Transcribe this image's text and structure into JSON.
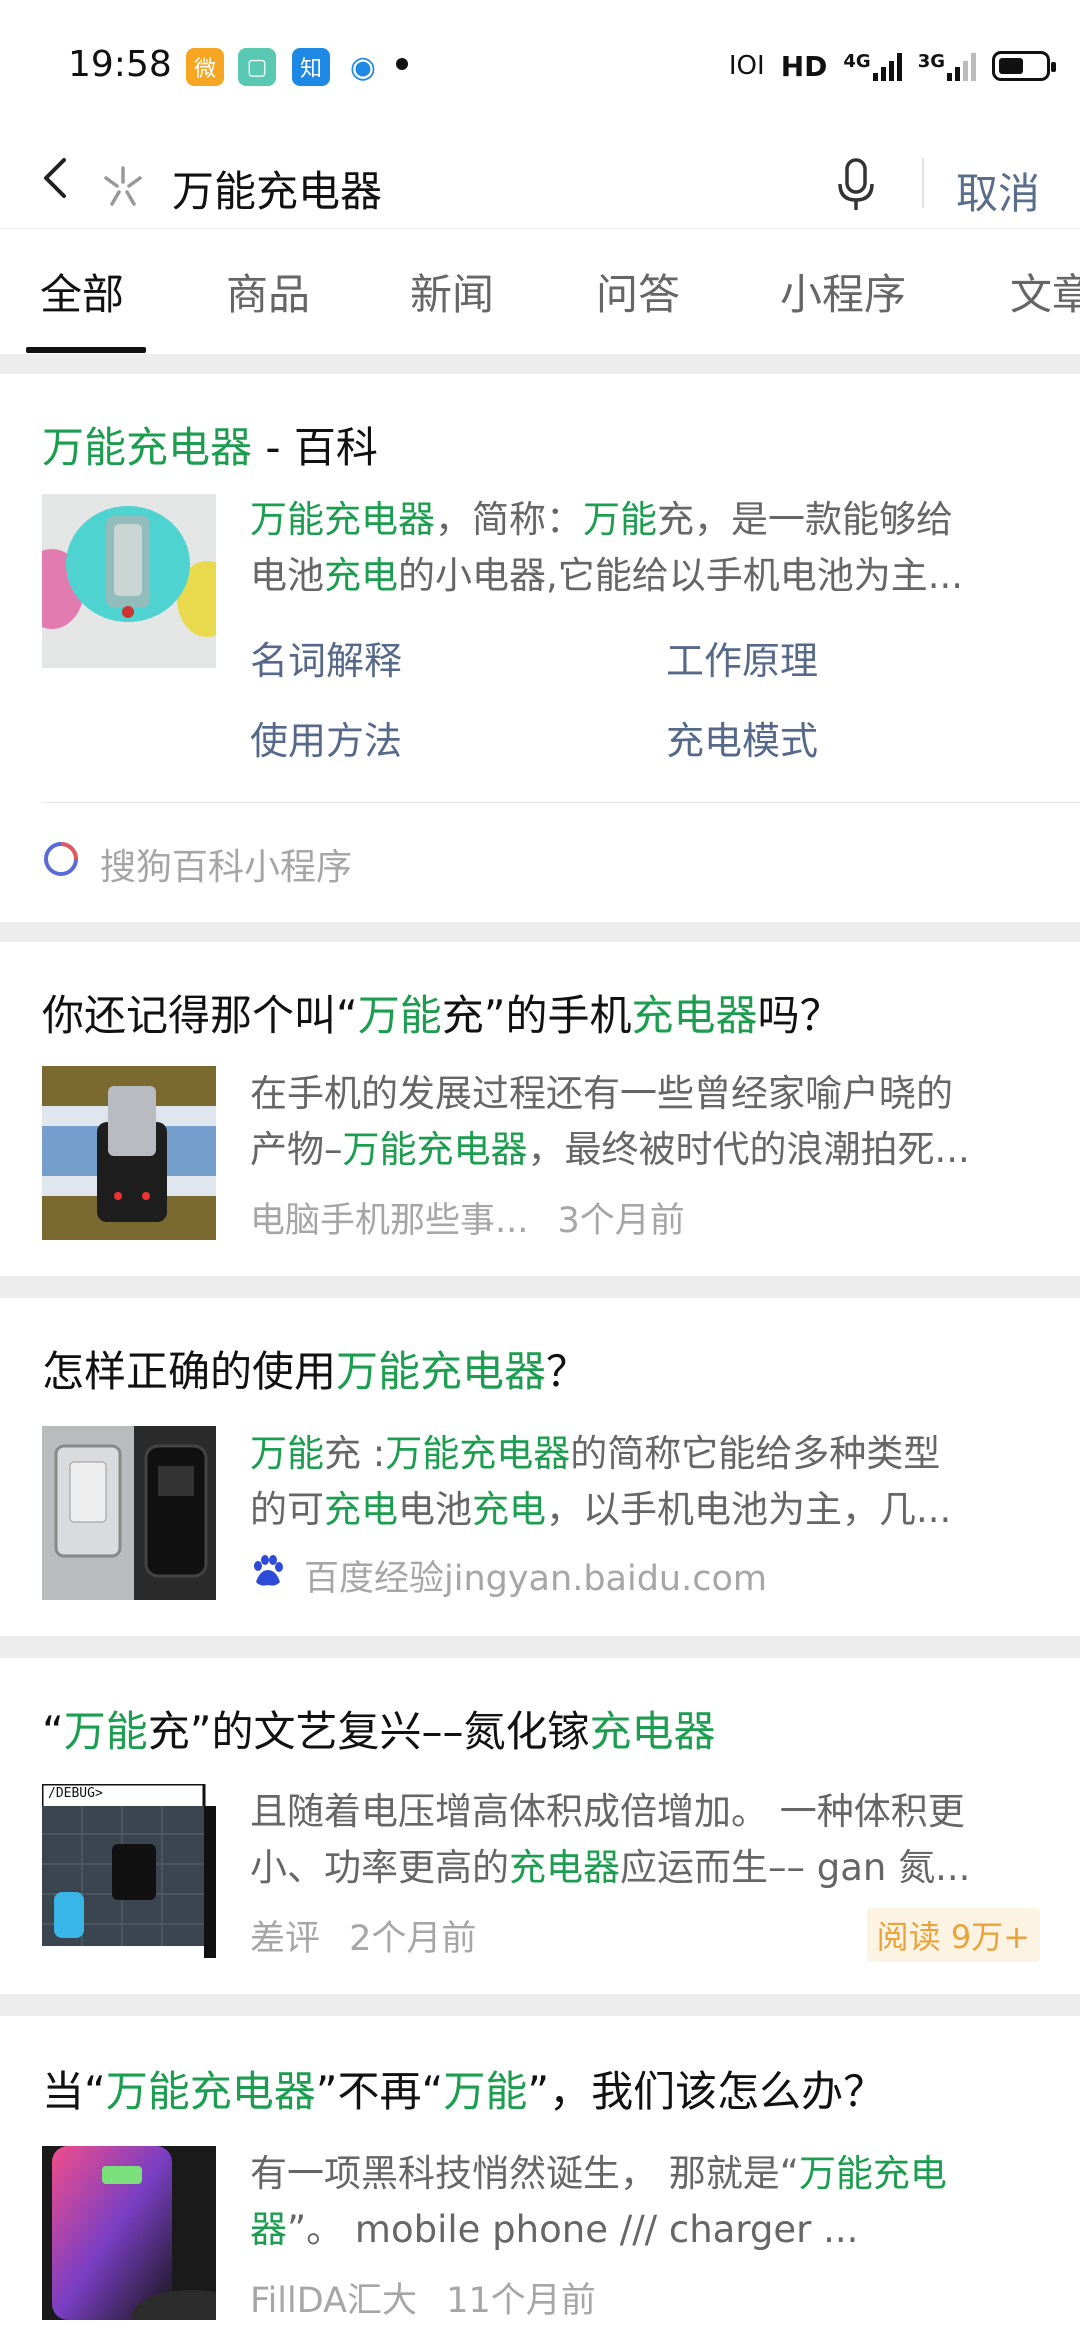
{
  "status_bar": {
    "time": "19:58",
    "apps": [
      {
        "name": "weibo-app-icon",
        "glyph": "微",
        "color": "#f6a623"
      },
      {
        "name": "gallery-app-icon",
        "glyph": "▢",
        "color": "#59c9b3"
      },
      {
        "name": "zhihu-app-icon",
        "glyph": "知",
        "color": "#1e88e5"
      },
      {
        "name": "browser-app-icon",
        "glyph": "◉",
        "color": "#1e88e5"
      }
    ],
    "vibrate": "ⅠOⅠ",
    "hd": "HD",
    "net_4g": "4G",
    "net_3g": "3G"
  },
  "search": {
    "query": "万能充电器",
    "cancel_label": "取消"
  },
  "tabs": [
    {
      "label": "全部",
      "active": true
    },
    {
      "label": "商品"
    },
    {
      "label": "新闻"
    },
    {
      "label": "问答"
    },
    {
      "label": "小程序"
    },
    {
      "label": "文章"
    }
  ],
  "baike": {
    "title_hl": "万能充电器",
    "title_rest": " - 百科",
    "desc_line1": [
      {
        "t": "万能充电器",
        "hl": true
      },
      {
        "t": "，简称："
      },
      {
        "t": "万能",
        "hl": true
      },
      {
        "t": "充，是一款能够给"
      }
    ],
    "desc_line2": [
      {
        "t": "电池"
      },
      {
        "t": "充电",
        "hl": true
      },
      {
        "t": "的小电器,它能给以手机电池为主..."
      }
    ],
    "links": [
      "名词解释",
      "工作原理",
      "使用方法",
      "充电模式"
    ],
    "source": "搜狗百科小程序"
  },
  "results": [
    {
      "title": [
        {
          "t": "你还记得那个叫“"
        },
        {
          "t": "万能",
          "hl": true
        },
        {
          "t": "充”的手机"
        },
        {
          "t": "充电器",
          "hl": true
        },
        {
          "t": "吗？"
        }
      ],
      "desc_line1": [
        {
          "t": "在手机的发展过程还有一些曾经家喻户晓的"
        }
      ],
      "desc_line2": [
        {
          "t": "产物–"
        },
        {
          "t": "万能充电器",
          "hl": true
        },
        {
          "t": "，最终被时代的浪潮拍死..."
        }
      ],
      "source": "电脑手机那些事...",
      "time": "3个月前"
    },
    {
      "title": [
        {
          "t": "怎样正确的使用"
        },
        {
          "t": "万能充电器",
          "hl": true
        },
        {
          "t": "？"
        }
      ],
      "desc_line1": [
        {
          "t": "万能",
          "hl": true
        },
        {
          "t": "充 :"
        },
        {
          "t": "万能充电器",
          "hl": true
        },
        {
          "t": "的简称它能给多种类型"
        }
      ],
      "desc_line2": [
        {
          "t": "的可"
        },
        {
          "t": "充电",
          "hl": true
        },
        {
          "t": "电池"
        },
        {
          "t": "充电",
          "hl": true
        },
        {
          "t": "，以手机电池为主，几..."
        }
      ],
      "source": "百度经验jingyan.baidu.com"
    },
    {
      "title": [
        {
          "t": "“"
        },
        {
          "t": "万能",
          "hl": true
        },
        {
          "t": "充”的文艺复兴––氮化镓"
        },
        {
          "t": "充电器",
          "hl": true
        }
      ],
      "desc_line1": [
        {
          "t": "且随着电压增高体积成倍增加。 一种体积更"
        }
      ],
      "desc_line2": [
        {
          "t": "小、功率更高的"
        },
        {
          "t": "充电器",
          "hl": true
        },
        {
          "t": "应运而生–– gan 氮..."
        }
      ],
      "source": "差评",
      "time": "2个月前",
      "badge": "阅读 9万+",
      "thumb_label": "/DEBUG>"
    },
    {
      "title": [
        {
          "t": "当“"
        },
        {
          "t": "万能充电器",
          "hl": true
        },
        {
          "t": "”不再“"
        },
        {
          "t": "万能",
          "hl": true
        },
        {
          "t": "”，我们该怎么办？"
        }
      ],
      "desc_line1": [
        {
          "t": "有一项黑科技悄然诞生， 那就是“"
        },
        {
          "t": "万能充电",
          "hl": true
        }
      ],
      "desc_line2": [
        {
          "t": "器",
          "hl": true
        },
        {
          "t": "”。 mobile phone /// charger ..."
        }
      ],
      "source": "FillDA汇大",
      "time": "11个月前"
    }
  ]
}
